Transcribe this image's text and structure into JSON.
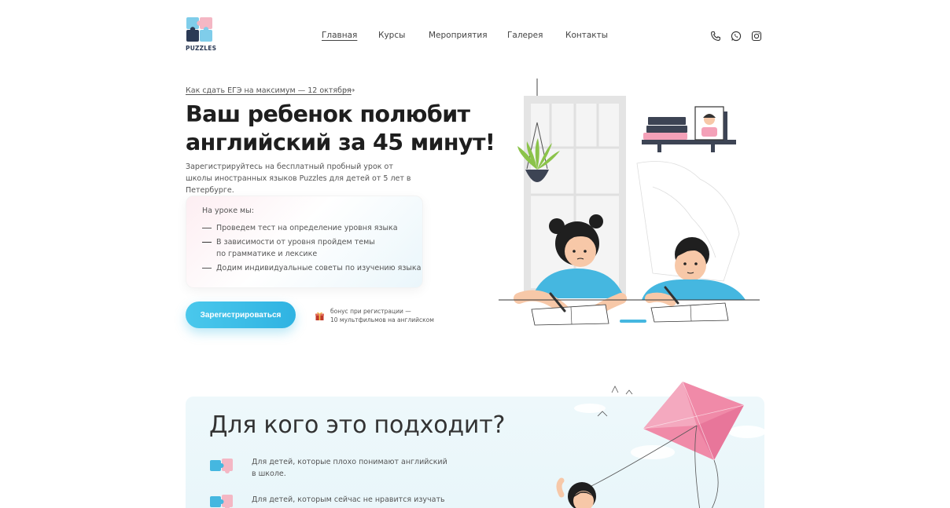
{
  "brand": {
    "name": "PUZZLES"
  },
  "nav": [
    {
      "label": "Главная",
      "active": true
    },
    {
      "label": "Курсы",
      "active": false
    },
    {
      "label": "Мероприятия",
      "active": false
    },
    {
      "label": "Галерея",
      "active": false
    },
    {
      "label": "Контакты",
      "active": false
    }
  ],
  "socials": [
    "phone-icon",
    "whatsapp-icon",
    "instagram-icon"
  ],
  "hero": {
    "event_link": "Как сдать ЕГЭ на максимум — 12 октября",
    "event_arrow": "⟶",
    "title": "Ваш ребенок полюбит английский за 45 минут!",
    "subtitle": "Зарегистрируйтесь на бесплатный пробный урок от школы иностранных языков Puzzles для детей от 5 лет в Петербурге.",
    "card": {
      "title": "На уроке мы:",
      "items": [
        "Проведем тест на определение уровня языка",
        "В зависимости от уровня пройдем темы\nпо грамматике и лексике",
        "Додим индивидуальные советы по изучению языка"
      ]
    },
    "register_button": "Зарегистрироваться",
    "bonus_text": "бонус при регистрации —\n10 мультфильмов на английском"
  },
  "section2": {
    "title": "Для кого это подходит?",
    "items": [
      "Для детей, которые плохо понимают английский\nв школе.",
      "Для детей, которым сейчас не нравится изучать"
    ]
  },
  "colors": {
    "accent": "#35b9e5",
    "pink": "#f0a3b5",
    "navy": "#2b3a55",
    "section_bg": "#eaf6fa"
  }
}
